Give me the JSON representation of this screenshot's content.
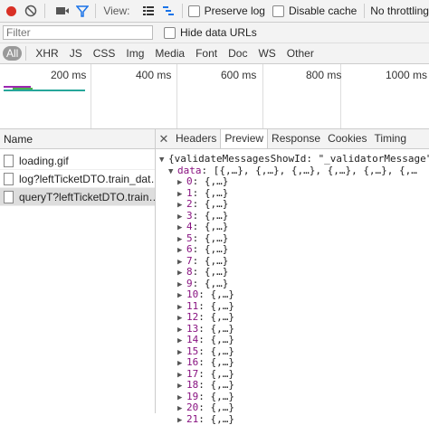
{
  "toolbar": {
    "view_label": "View:",
    "preserve_log": "Preserve log",
    "disable_cache": "Disable cache",
    "throttling": "No throttling",
    "colors": {
      "record": "#d93025",
      "filter_active": "#1a73e8"
    }
  },
  "filter": {
    "placeholder": "Filter",
    "hide_data_urls": "Hide data URLs"
  },
  "types": [
    "All",
    "XHR",
    "JS",
    "CSS",
    "Img",
    "Media",
    "Font",
    "Doc",
    "WS",
    "Other"
  ],
  "timeline": {
    "ticks": [
      "200 ms",
      "400 ms",
      "600 ms",
      "800 ms",
      "1000 ms"
    ]
  },
  "requests": {
    "header": "Name",
    "items": [
      {
        "name": "loading.gif"
      },
      {
        "name": "log?leftTicketDTO.train_dat…"
      },
      {
        "name": "queryT?leftTicketDTO.train…"
      }
    ]
  },
  "detail": {
    "tabs": [
      "Headers",
      "Preview",
      "Response",
      "Cookies",
      "Timing"
    ],
    "active_tab": "Preview",
    "root_line": "{validateMessagesShowId: \"_validatorMessage\",…",
    "data_key": "data",
    "data_summary": "[{,…}, {,…}, {,…}, {,…}, {,…}, {,…",
    "entries": [
      "0",
      "1",
      "2",
      "3",
      "4",
      "5",
      "6",
      "7",
      "8",
      "9",
      "10",
      "11",
      "12",
      "13",
      "14",
      "15",
      "16",
      "17",
      "18",
      "19",
      "20",
      "21"
    ],
    "entry_value": "{,…}"
  }
}
